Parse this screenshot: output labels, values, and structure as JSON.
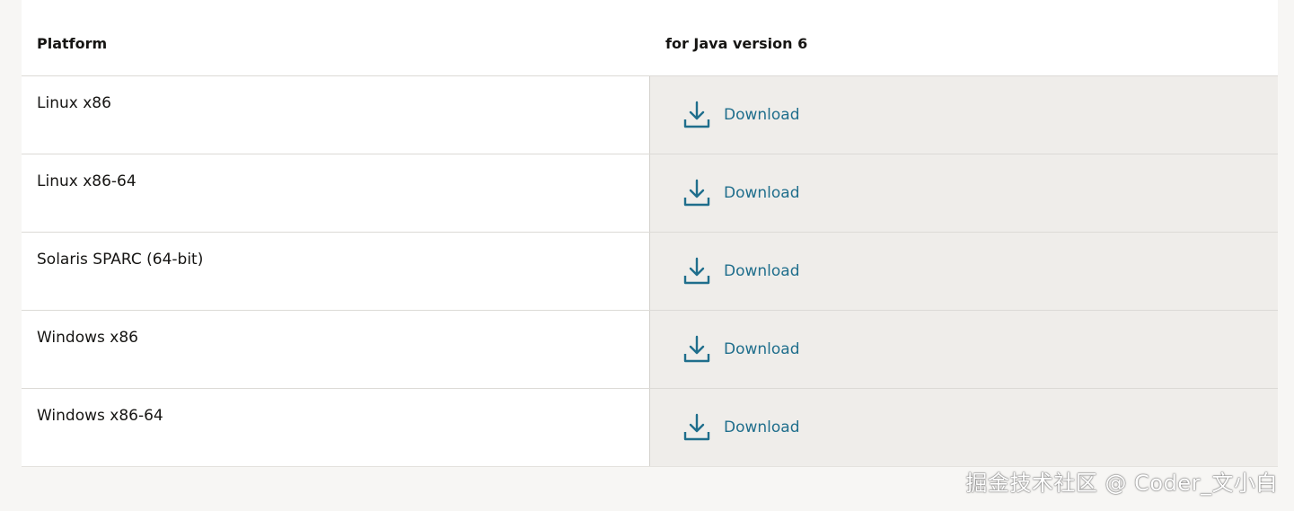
{
  "table": {
    "header": {
      "platform": "Platform",
      "java_version": "for Java version 6"
    },
    "rows": [
      {
        "platform": "Linux x86",
        "download_label": "Download"
      },
      {
        "platform": "Linux x86-64",
        "download_label": "Download"
      },
      {
        "platform": "Solaris SPARC (64-bit)",
        "download_label": "Download"
      },
      {
        "platform": "Windows x86",
        "download_label": "Download"
      },
      {
        "platform": "Windows x86-64",
        "download_label": "Download"
      }
    ]
  },
  "watermark": {
    "text": "掘金技术社区 @ Coder_文小白"
  },
  "icons": {
    "download": "download-icon"
  },
  "colors": {
    "link": "#1f6e8c",
    "download_cell_bg": "#efedea",
    "page_bg": "#f7f6f4"
  }
}
